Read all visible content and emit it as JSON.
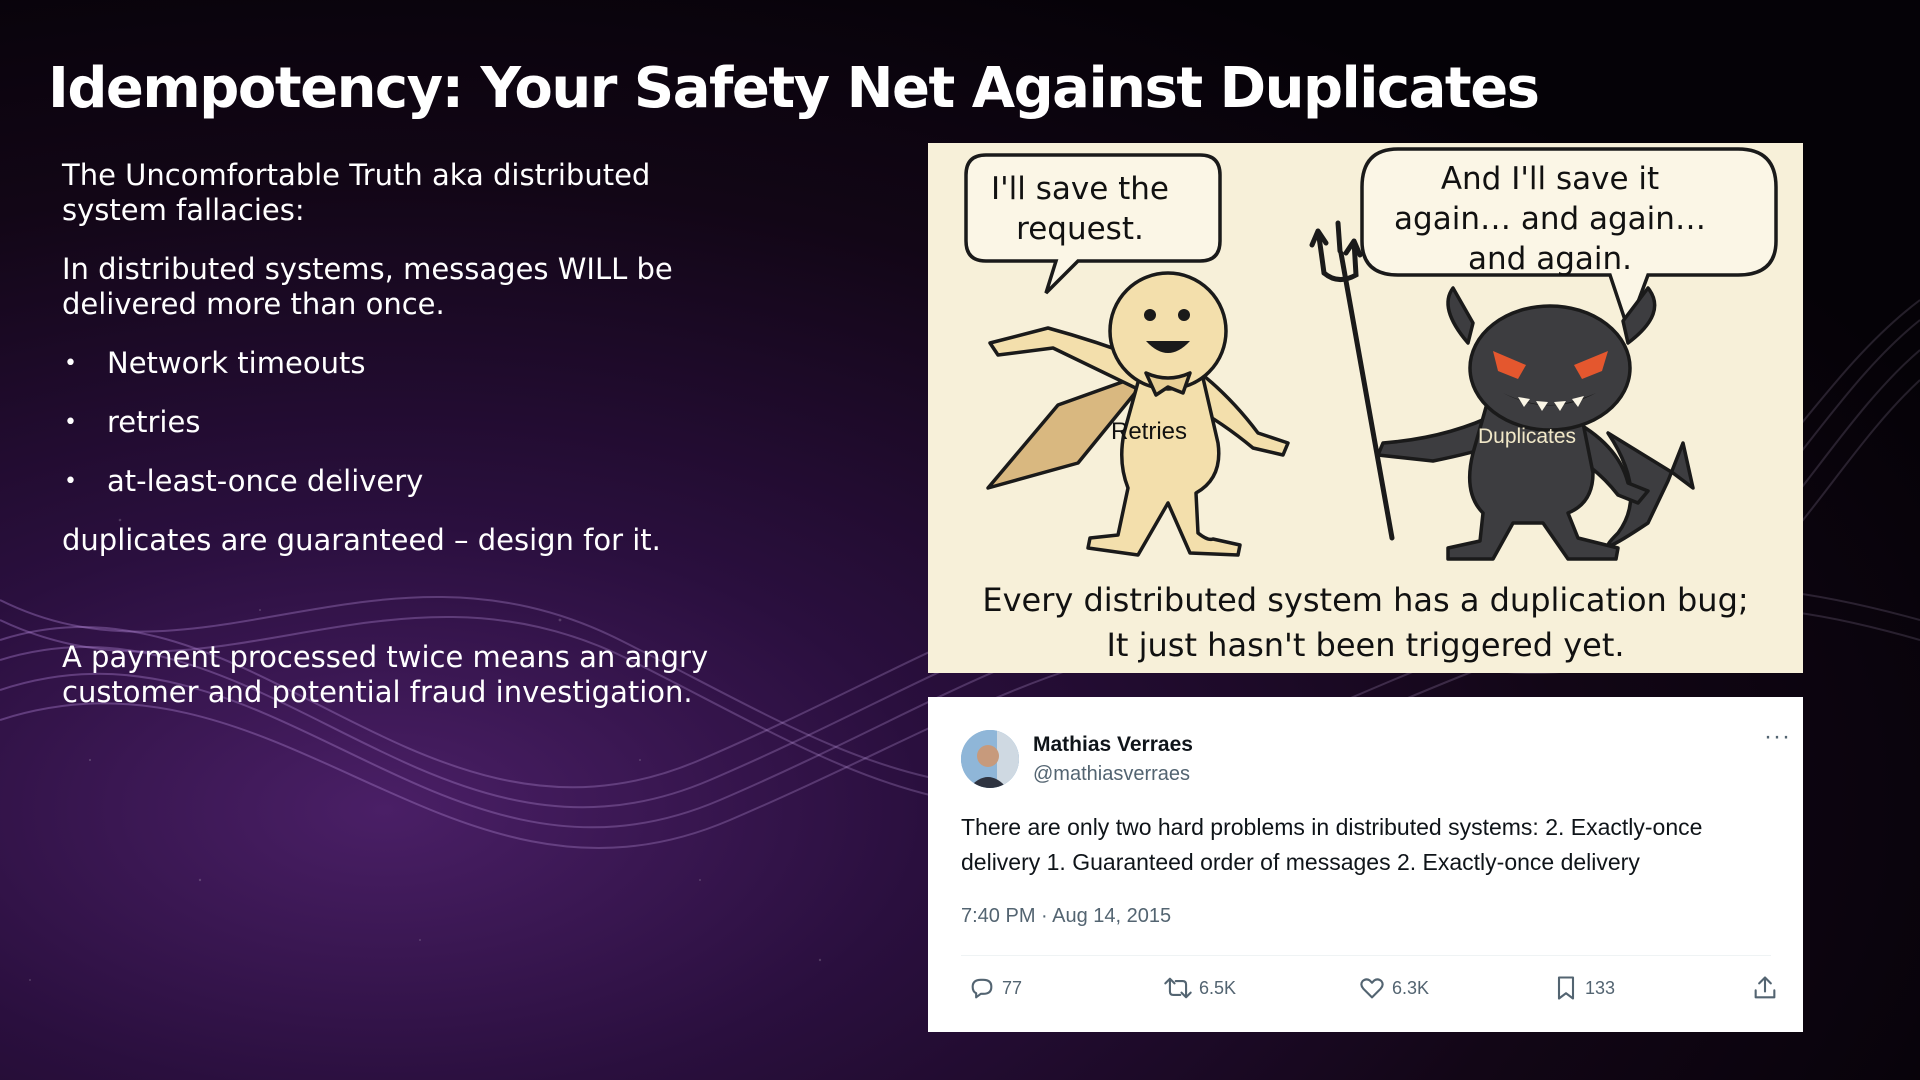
{
  "slide": {
    "title": "Idempotency: Your Safety Net Against Duplicates"
  },
  "left": {
    "para1": "The Uncomfortable Truth aka distributed system fallacies:",
    "para2": "In distributed systems, messages WILL be delivered more than once.",
    "bullet_glyph": "•",
    "bullets": [
      "Network timeouts",
      "retries",
      "at-least-once delivery"
    ],
    "para3": "duplicates are guaranteed – design for it.",
    "para4": "A payment processed twice means an angry customer and potential fraud investigation."
  },
  "comic": {
    "bubble_left": "I'll save the request.",
    "bubble_right": "And I'll save it again… and again… and again.",
    "label_hero": "Retries",
    "label_devil": "Duplicates",
    "caption_line1": "Every distributed system has a duplication bug;",
    "caption_line2": "It just hasn't been triggered yet.",
    "colors": {
      "background": "#f7f0d9",
      "hero": "#f3dfac",
      "devil": "#3d3d40",
      "eyes": "#e4572e"
    }
  },
  "tweet": {
    "name": "Mathias Verraes",
    "handle": "@mathiasverraes",
    "more": "···",
    "text": "There are only two hard problems in distributed systems:  2. Exactly-once delivery 1. Guaranteed order of messages 2. Exactly-once delivery",
    "timestamp": "7:40 PM · Aug 14, 2015",
    "actions": {
      "replies": {
        "icon": "reply-icon",
        "count": "77"
      },
      "retweets": {
        "icon": "retweet-icon",
        "count": "6.5K"
      },
      "likes": {
        "icon": "heart-icon",
        "count": "6.3K"
      },
      "bookmarks": {
        "icon": "bookmark-icon",
        "count": "133"
      },
      "share": {
        "icon": "share-icon"
      }
    }
  }
}
